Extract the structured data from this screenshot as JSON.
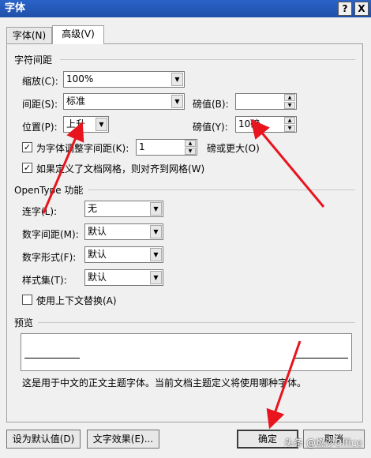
{
  "window": {
    "title": "字体",
    "help": "?",
    "close": "X"
  },
  "tabs": [
    {
      "label": "字体(N)"
    },
    {
      "label": "高级(V)"
    }
  ],
  "spacing": {
    "section_title": "字符间距",
    "scale_label": "缩放(C):",
    "scale_value": "100%",
    "spacing_label": "间距(S):",
    "spacing_value": "标准",
    "spacing_pts_label": "磅值(B):",
    "spacing_pts_value": "",
    "position_label": "位置(P):",
    "position_value": "上升",
    "position_pts_label": "磅值(Y):",
    "position_pts_value": "10磅",
    "kerning_label": "为字体调整字间距(K):",
    "kerning_value": "1",
    "kerning_suffix": "磅或更大(O)",
    "grid_label": "如果定义了文档网格，则对齐到网格(W)"
  },
  "opentype": {
    "section_title": "OpenType 功能",
    "ligatures_label": "连字(L):",
    "ligatures_value": "无",
    "num_spacing_label": "数字间距(M):",
    "num_spacing_value": "默认",
    "num_form_label": "数字形式(F):",
    "num_form_value": "默认",
    "style_sets_label": "样式集(T):",
    "style_sets_value": "默认",
    "contextual_label": "使用上下文替换(A)"
  },
  "preview": {
    "section_title": "预览",
    "description": "这是用于中文的正文主题字体。当前文档主题定义将使用哪种字体。"
  },
  "buttons": {
    "set_default": "设为默认值(D)",
    "text_effects": "文字效果(E)...",
    "ok": "确定",
    "cancel": "取消"
  },
  "watermark": "头条 @燃沙Office",
  "colors": {
    "annotation_arrow": "#e8141e",
    "titlebar": "#2a63c8"
  }
}
